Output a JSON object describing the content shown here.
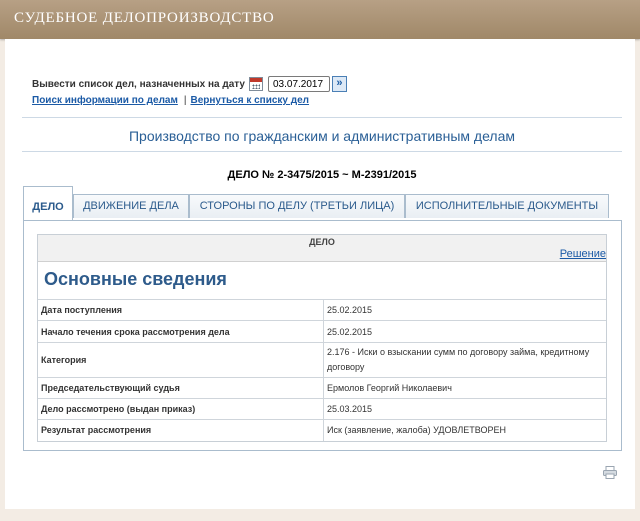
{
  "header": {
    "title": "СУДЕБНОЕ ДЕЛОПРОИЗВОДСТВО"
  },
  "date_filter": {
    "label": "Вывести список дел, назначенных на дату",
    "date_value": "03.07.2017",
    "calendar_icon": "calendar-icon",
    "go_icon": "double-chevron-right-icon"
  },
  "links": {
    "search": "Поиск информации по делам",
    "separator": "|",
    "back": "Вернуться к списку дел"
  },
  "section_title": "Производство по гражданским и административным делам",
  "case_number": "ДЕЛО № 2-3475/2015 ~ М-2391/2015",
  "tabs": [
    {
      "label": "ДЕЛО",
      "active": true
    },
    {
      "label": "ДВИЖЕНИЕ ДЕЛА",
      "active": false
    },
    {
      "label": "СТОРОНЫ ПО ДЕЛУ (ТРЕТЬИ ЛИЦА)",
      "active": false
    },
    {
      "label": "ИСПОЛНИТЕЛЬНЫЕ ДОКУМЕНТЫ",
      "active": false
    }
  ],
  "panel": {
    "head_title": "ДЕЛО",
    "decision_link": "Решение",
    "subheading": "Основные сведения",
    "rows": [
      {
        "label": "Дата поступления",
        "value": "25.02.2015"
      },
      {
        "label": "Начало течения срока рассмотрения дела",
        "value": "25.02.2015"
      },
      {
        "label": "Категория",
        "value_line1": "2.176 - Иски о взыскании сумм по договору займа, кредитному",
        "value_line2": "договору"
      },
      {
        "label": "Председательствующий судья",
        "value": "Ермолов Георгий Николаевич"
      },
      {
        "label": "Дело рассмотрено (выдан приказ)",
        "value": "25.03.2015"
      },
      {
        "label": "Результат рассмотрения",
        "value": "Иск (заявление, жалоба) УДОВЛЕТВОРЕН"
      }
    ]
  },
  "print_icon": "printer-icon",
  "colors": {
    "header": "#a8906f",
    "link": "#1b5aa6",
    "title": "#2a5f96"
  }
}
